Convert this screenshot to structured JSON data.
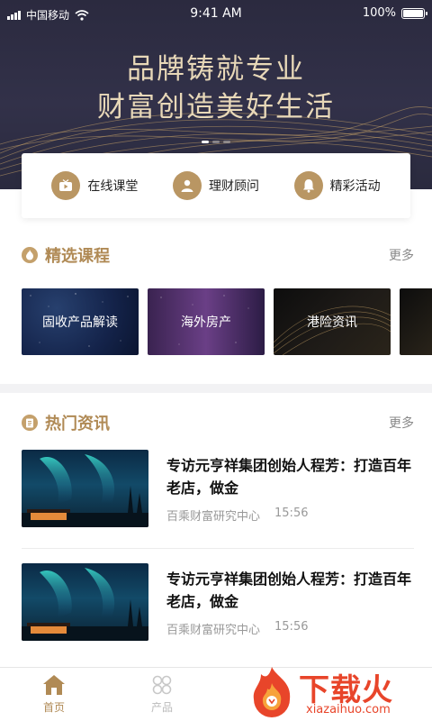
{
  "status_bar": {
    "carrier": "中国移动",
    "time": "9:41 AM",
    "battery": "100%"
  },
  "hero": {
    "title_line1": "品牌铸就专业",
    "title_line2": "财富创造美好生活"
  },
  "quick_links": [
    {
      "label": "在线课堂",
      "icon": "play-tv-icon"
    },
    {
      "label": "理财顾问",
      "icon": "advisor-icon"
    },
    {
      "label": "精彩活动",
      "icon": "bell-icon"
    }
  ],
  "courses_section": {
    "title": "精选课程",
    "more": "更多",
    "items": [
      {
        "label": "固收产品解读"
      },
      {
        "label": "海外房产"
      },
      {
        "label": "港险资讯"
      }
    ]
  },
  "news_section": {
    "title": "热门资讯",
    "more": "更多",
    "items": [
      {
        "title": "专访元亨祥集团创始人程芳：打造百年老店，做金",
        "source": "百乘财富研究中心",
        "time": "15:56"
      },
      {
        "title": "专访元亨祥集团创始人程芳：打造百年老店，做金",
        "source": "百乘财富研究中心",
        "time": "15:56"
      }
    ]
  },
  "tabbar": {
    "tabs": [
      {
        "label": "首页",
        "icon": "home-icon",
        "active": true
      },
      {
        "label": "产品",
        "icon": "product-icon",
        "active": false
      }
    ]
  },
  "watermark": {
    "text": "下载火",
    "sub": "xiazaihuo.com"
  },
  "colors": {
    "gold": "#b08a55",
    "hero_bg": "#2f2e44",
    "icon_gold": "#b99663"
  }
}
